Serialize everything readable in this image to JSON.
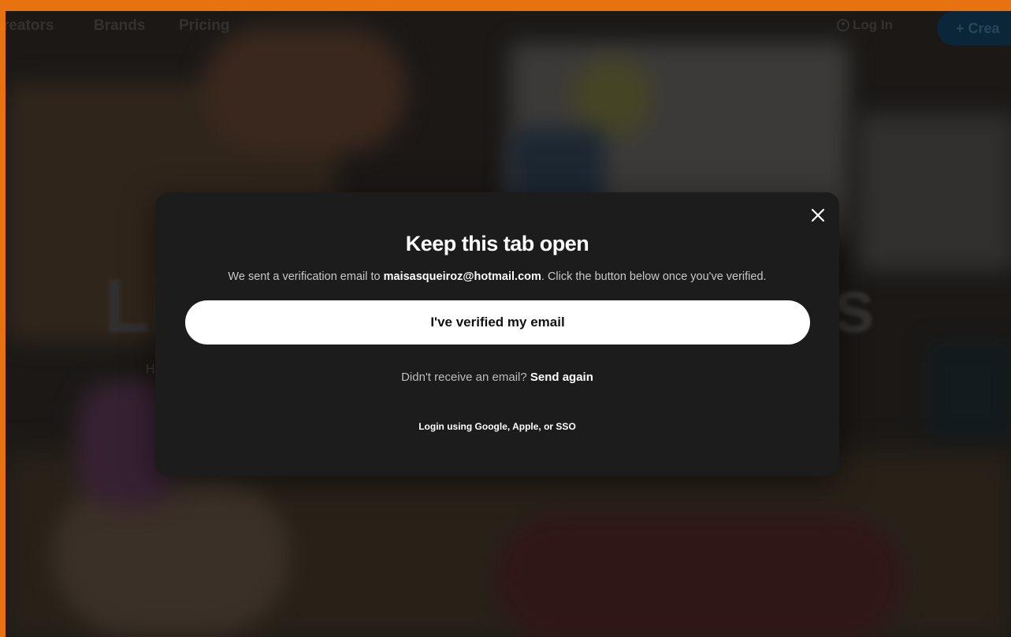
{
  "nav": {
    "creators": "reators",
    "brands": "Brands",
    "pricing": "Pricing",
    "login": "Log In",
    "create": "+ Crea"
  },
  "background": {
    "headline_left": "Li",
    "headline_right": "s",
    "sub_fragment": "H"
  },
  "modal": {
    "title": "Keep this tab open",
    "desc_prefix": "We sent a verification email to ",
    "email": "maisasqueiroz@hotmail.com",
    "desc_suffix": ". Click the button below once you've verified.",
    "verify_button": "I've verified my email",
    "resend_prompt": "Didn't receive an email? ",
    "resend_link": "Send again",
    "alt_login": "Login using Google, Apple, or SSO"
  },
  "colors": {
    "frame_border": "#e8720f",
    "modal_bg": "#1c1c1c",
    "button_bg": "#ffffff"
  },
  "icons": {
    "close": "close-icon",
    "user": "user-icon"
  }
}
